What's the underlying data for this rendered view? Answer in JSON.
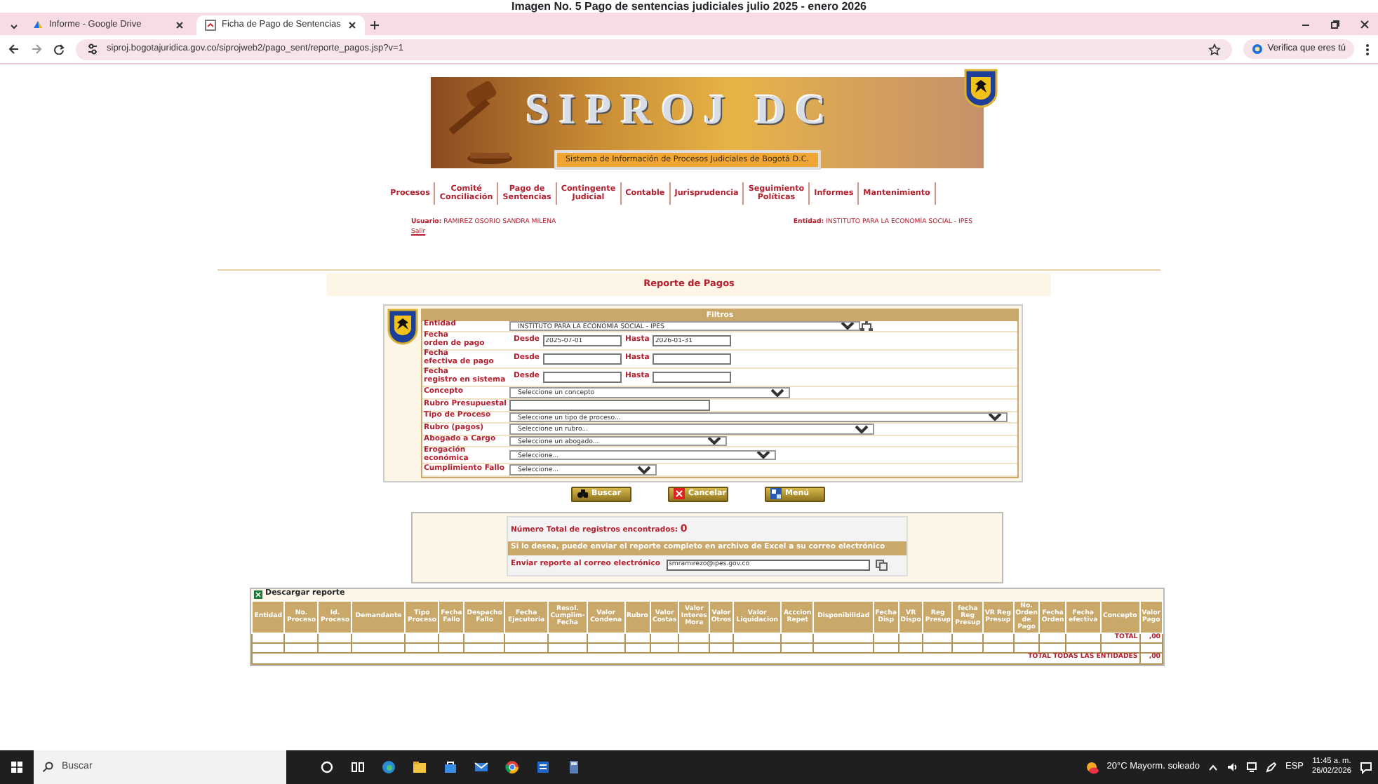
{
  "caption": "Imagen No. 5 Pago de sentencias judiciales julio 2025 - enero 2026",
  "browser": {
    "tabs": [
      {
        "title": "Informe - Google Drive",
        "selected": false
      },
      {
        "title": "Ficha de Pago de Sentencias",
        "selected": true
      }
    ],
    "url": "siproj.bogotajuridica.gov.co/siprojweb2/pago_sent/reporte_pagos.jsp?v=1",
    "profile_button": "Verifica que eres tú"
  },
  "header": {
    "logo_title": "SIPROJ DC",
    "subtitle": "Sistema de Información de Procesos Judiciales de Bogotá D.C."
  },
  "menu": [
    "Procesos",
    "Comité\nConciliación",
    "Pago de\nSentencias",
    "Contingente\nJudicial",
    "Contable",
    "Jurisprudencia",
    "Seguimiento\nPolíticas",
    "Informes",
    "Mantenimiento"
  ],
  "user": {
    "label": "Usuario:",
    "value": "RAMIREZ OSORIO SANDRA MILENA",
    "logout": "Salir"
  },
  "entity": {
    "label": "Entidad:",
    "value": "INSTITUTO PARA LA ECONOMÍA SOCIAL - IPES"
  },
  "page_title": "Reporte de Pagos",
  "filters": {
    "title": "Filtros",
    "rows": [
      {
        "kind": "select",
        "label": "Entidad",
        "value": "INSTITUTO PARA LA ECONOMÍA SOCIAL - IPES"
      },
      {
        "kind": "range",
        "label": "Fecha\norden de pago",
        "from_label": "Desde",
        "from": "2025-07-01",
        "to_label": "Hasta",
        "to": "2026-01-31"
      },
      {
        "kind": "range",
        "label": "Fecha\nefectiva de pago",
        "from_label": "Desde",
        "to_label": "Hasta"
      },
      {
        "kind": "range",
        "label": "Fecha\nregistro en sistema",
        "from_label": "Desde",
        "to_label": "Hasta"
      },
      {
        "kind": "select",
        "label": "Concepto",
        "value": "Seleccione un concepto"
      },
      {
        "kind": "text",
        "label": "Rubro Presupuestal"
      },
      {
        "kind": "select",
        "label": "Tipo de Proceso",
        "value": "Seleccione un tipo de proceso..."
      },
      {
        "kind": "select",
        "label": "Rubro (pagos)",
        "value": "Seleccione un rubro..."
      },
      {
        "kind": "select",
        "label": "Abogado a Cargo",
        "value": "Seleccione un abogado..."
      },
      {
        "kind": "select",
        "label": "Erogación económica",
        "value": "Seleccione..."
      },
      {
        "kind": "select",
        "label": "Cumplimiento Fallo",
        "value": "Seleccione..."
      }
    ]
  },
  "buttons": [
    "Buscar",
    "Cancelar",
    "Menú"
  ],
  "results": {
    "count_label": "Número Total de registros encontrados:",
    "count": "0",
    "notice": "Si lo desea, puede enviar el reporte completo en archivo de Excel a su correo electrónico",
    "email_label": "Enviar reporte al correo electrónico",
    "email": "smramirezo@ipes.gov.co"
  },
  "report": {
    "title": "Descargar reporte",
    "columns": [
      "Entidad",
      "No.\nProceso",
      "Id.\nProceso",
      "Demandante",
      "Tipo\nProceso",
      "Fecha\nFallo",
      "Despacho\nFallo",
      "Fecha\nEjecutoria",
      "Resol.\nCumplim-\nFecha",
      "Valor\nCondena",
      "Rubro",
      "Valor\nCostas",
      "Valor\nInteres\nMora",
      "Valor\nOtros",
      "Valor\nLiquidacion",
      "Acccion\nRepet",
      "Disponibilidad",
      "Fecha\nDisp",
      "VR\nDispo",
      "Reg\nPresup",
      "fecha\nReg\nPresup",
      "VR Reg\nPresup",
      "No.\nOrden\nde\nPago",
      "Fecha\nOrden",
      "Fecha\nefectiva",
      "Concepto",
      "Valor\nPago"
    ],
    "total_label": "TOTAL",
    "total": ",00",
    "grand_total_label": "TOTAL TODAS LAS ENTIDADES",
    "grand_total": ",00"
  },
  "taskbar": {
    "search_placeholder": "Buscar",
    "weather": "20°C  Mayorm. soleado",
    "language": "ESP",
    "time": "11:45 a. m.",
    "date": "26/02/2026"
  }
}
